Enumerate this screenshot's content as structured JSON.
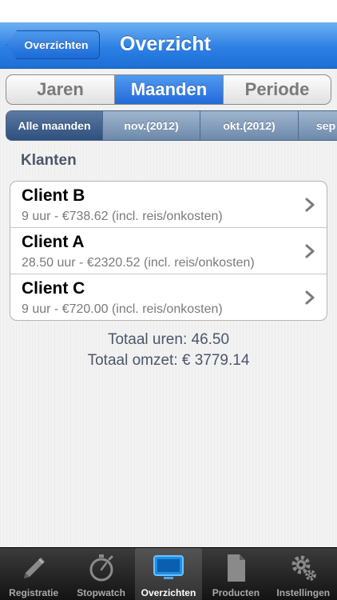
{
  "navbar": {
    "back_label": "Overzichten",
    "title": "Overzicht"
  },
  "period_segments": [
    {
      "label": "Jaren",
      "active": false
    },
    {
      "label": "Maanden",
      "active": true
    },
    {
      "label": "Periode",
      "active": false
    }
  ],
  "months": [
    {
      "label": "Alle maanden",
      "active": true
    },
    {
      "label": "nov.(2012)",
      "active": false
    },
    {
      "label": "okt.(2012)",
      "active": false
    },
    {
      "label": "sep",
      "active": false
    }
  ],
  "section": {
    "title": "Klanten"
  },
  "clients": [
    {
      "name": "Client B",
      "detail": "9 uur - €738.62 (incl. reis/onkosten)"
    },
    {
      "name": "Client A",
      "detail": "28.50 uur - €2320.52 (incl. reis/onkosten)"
    },
    {
      "name": "Client C",
      "detail": "9 uur - €720.00 (incl. reis/onkosten)"
    }
  ],
  "totals": {
    "hours": "Totaal uren: 46.50",
    "revenue": "Totaal omzet: € 3779.14"
  },
  "tabbar": {
    "items": [
      {
        "label": "Registratie",
        "icon": "pencil-icon",
        "active": false
      },
      {
        "label": "Stopwatch",
        "icon": "stopwatch-icon",
        "active": false
      },
      {
        "label": "Overzichten",
        "icon": "monitor-icon",
        "active": true
      },
      {
        "label": "Producten",
        "icon": "document-icon",
        "active": false
      },
      {
        "label": "Instellingen",
        "icon": "gears-icon",
        "active": false
      }
    ]
  }
}
